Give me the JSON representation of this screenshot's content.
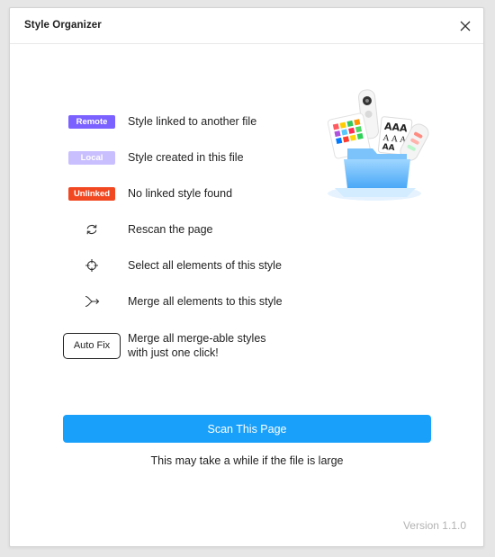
{
  "window": {
    "title": "Style Organizer"
  },
  "legend": {
    "remote": {
      "badge": "Remote",
      "text": "Style linked to another file",
      "color": "#7b61ff"
    },
    "local": {
      "badge": "Local",
      "text": "Style created in this file",
      "color": "#c9bfff"
    },
    "unlinked": {
      "badge": "Unlinked",
      "text": "No linked style found",
      "color": "#f24822"
    },
    "rescan": {
      "icon": "rescan-icon",
      "text": "Rescan the page"
    },
    "select": {
      "icon": "target-icon",
      "text": "Select all elements of this style"
    },
    "merge": {
      "icon": "merge-icon",
      "text": "Merge all elements to this style"
    },
    "autofix": {
      "button": "Auto Fix",
      "line1": "Merge all merge-able styles",
      "line2": "with just one click!"
    }
  },
  "actions": {
    "scan_label": "Scan This Page",
    "scan_note": "This may take a while if the file is large",
    "accent": "#18a0fb"
  },
  "footer": {
    "version": "Version 1.1.0"
  }
}
